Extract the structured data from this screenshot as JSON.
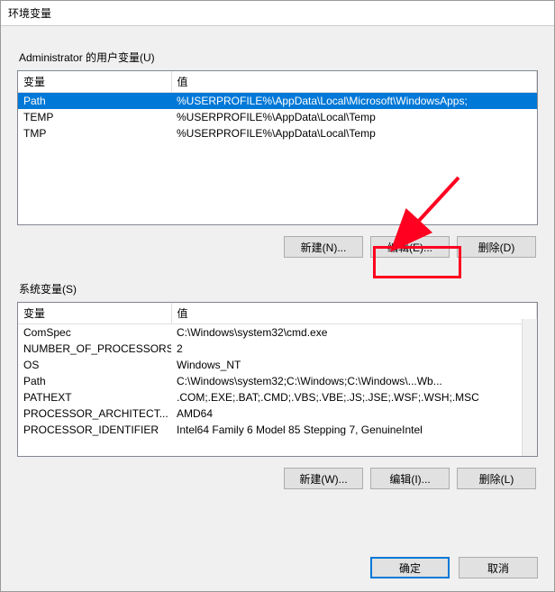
{
  "titlebar": {
    "text": "环境变量"
  },
  "user_section": {
    "label": "Administrator 的用户变量(U)",
    "columns": {
      "variable": "变量",
      "value": "值"
    },
    "rows": [
      {
        "variable": "Path",
        "value": "%USERPROFILE%\\AppData\\Local\\Microsoft\\WindowsApps;",
        "selected": true
      },
      {
        "variable": "TEMP",
        "value": "%USERPROFILE%\\AppData\\Local\\Temp",
        "selected": false
      },
      {
        "variable": "TMP",
        "value": "%USERPROFILE%\\AppData\\Local\\Temp",
        "selected": false
      }
    ],
    "buttons": {
      "new": "新建(N)...",
      "edit": "编辑(E)...",
      "delete": "删除(D)"
    }
  },
  "system_section": {
    "label": "系统变量(S)",
    "columns": {
      "variable": "变量",
      "value": "值"
    },
    "rows": [
      {
        "variable": "ComSpec",
        "value": "C:\\Windows\\system32\\cmd.exe"
      },
      {
        "variable": "NUMBER_OF_PROCESSORS",
        "value": "2"
      },
      {
        "variable": "OS",
        "value": "Windows_NT"
      },
      {
        "variable": "Path",
        "value": "C:\\Windows\\system32;C:\\Windows;C:\\Windows\\...Wb..."
      },
      {
        "variable": "PATHEXT",
        "value": ".COM;.EXE;.BAT;.CMD;.VBS;.VBE;.JS;.JSE;.WSF;.WSH;.MSC"
      },
      {
        "variable": "PROCESSOR_ARCHITECT...",
        "value": "AMD64"
      },
      {
        "variable": "PROCESSOR_IDENTIFIER",
        "value": "Intel64 Family 6 Model 85 Stepping 7, GenuineIntel"
      }
    ],
    "buttons": {
      "new": "新建(W)...",
      "edit": "编辑(I)...",
      "delete": "删除(L)"
    }
  },
  "footer": {
    "ok": "确定",
    "cancel": "取消"
  },
  "annotations": {
    "highlight_edit_button": true,
    "arrow_color": "#ff0020"
  }
}
